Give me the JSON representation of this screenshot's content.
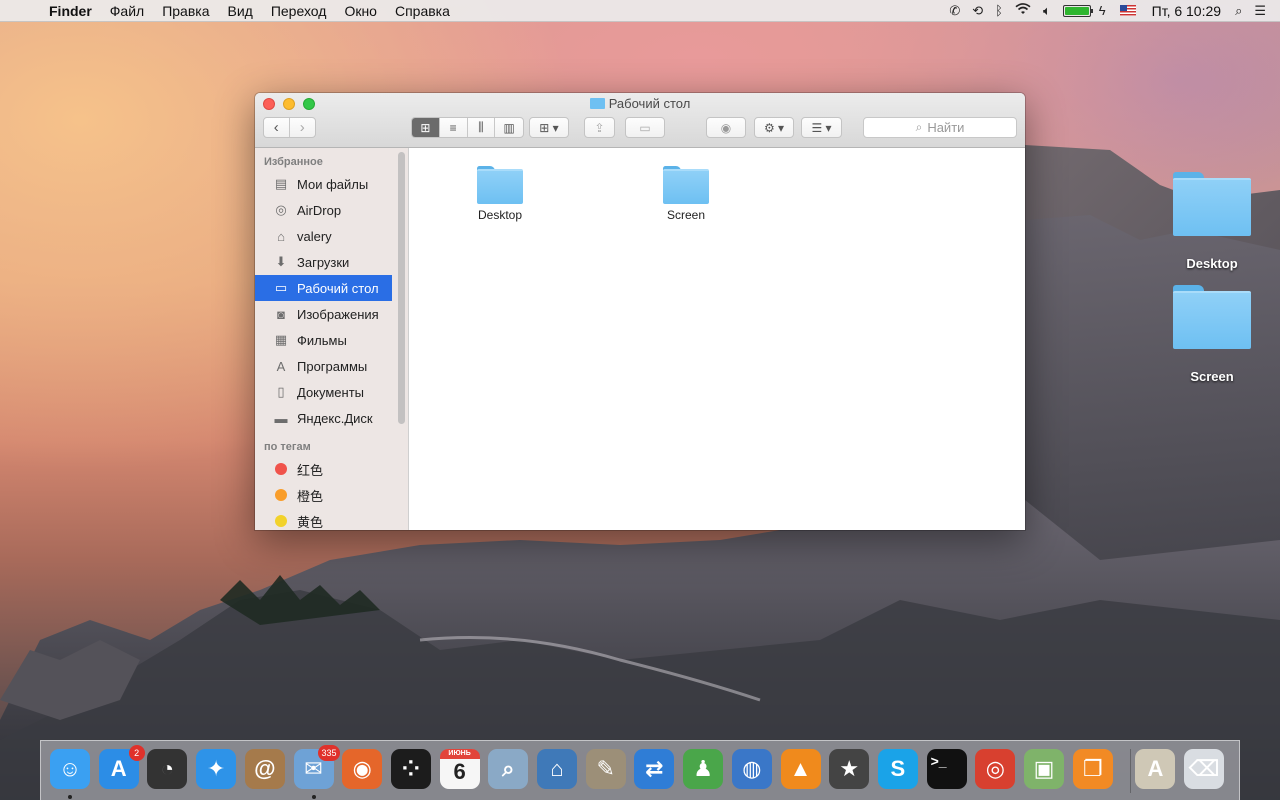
{
  "menubar": {
    "app_name": "Finder",
    "items": [
      "Файл",
      "Правка",
      "Вид",
      "Переход",
      "Окно",
      "Справка"
    ],
    "clock": "Пт, 6 10:29",
    "battery_level": 1.0
  },
  "desktop_icons": [
    {
      "label": "Desktop",
      "icon": "folder-icon"
    },
    {
      "label": "Screen",
      "icon": "folder-icon"
    }
  ],
  "window": {
    "title": "Рабочий стол",
    "search_placeholder": "Найти",
    "sidebar": {
      "favorites_header": "Избранное",
      "favorites": [
        {
          "label": "Мои файлы",
          "icon": "all-files-icon"
        },
        {
          "label": "AirDrop",
          "icon": "airdrop-icon"
        },
        {
          "label": "valery",
          "icon": "home-icon"
        },
        {
          "label": "Загрузки",
          "icon": "downloads-icon"
        },
        {
          "label": "Рабочий стол",
          "icon": "desktop-icon",
          "selected": true
        },
        {
          "label": "Изображения",
          "icon": "camera-icon"
        },
        {
          "label": "Фильмы",
          "icon": "film-icon"
        },
        {
          "label": "Программы",
          "icon": "applications-icon"
        },
        {
          "label": "Документы",
          "icon": "documents-icon"
        },
        {
          "label": "Яндекс.Диск",
          "icon": "folder-icon"
        }
      ],
      "tags_header": "по тегам",
      "tags": [
        {
          "label": "红色",
          "color": "#f0534b"
        },
        {
          "label": "橙色",
          "color": "#f99d2a"
        },
        {
          "label": "黄色",
          "color": "#f2d22b"
        }
      ]
    },
    "files": [
      {
        "label": "Desktop",
        "icon": "folder-icon"
      },
      {
        "label": "Screen",
        "icon": "folder-icon"
      }
    ]
  },
  "dock": {
    "apps": [
      {
        "name": "finder-icon",
        "color": "#3aa0f2",
        "glyph": "☺",
        "running": true
      },
      {
        "name": "app-store-icon",
        "color": "#2c8de6",
        "glyph": "A",
        "badge": "2"
      },
      {
        "name": "dashboard-icon",
        "color": "#333333",
        "glyph": "◔"
      },
      {
        "name": "safari-icon",
        "color": "#2e93e8",
        "glyph": "✦"
      },
      {
        "name": "contacts-icon",
        "color": "#a57a4b",
        "glyph": "@"
      },
      {
        "name": "mail-icon",
        "color": "#6ea2d6",
        "glyph": "✉",
        "badge": "335",
        "running": true
      },
      {
        "name": "firefox-icon",
        "color": "#e5662a",
        "glyph": "◉"
      },
      {
        "name": "blackberry-icon",
        "color": "#1c1c1c",
        "glyph": "⁘"
      },
      {
        "name": "calendar-icon",
        "color": "#f6f6f6",
        "glyph": "6"
      },
      {
        "name": "preview-icon",
        "color": "#8aa9c6",
        "glyph": "⌕"
      },
      {
        "name": "network-app-icon",
        "color": "#3f79b8",
        "glyph": "⌂"
      },
      {
        "name": "gimp-icon",
        "color": "#9c8f78",
        "glyph": "✎"
      },
      {
        "name": "teamviewer-icon",
        "color": "#2f7dd6",
        "glyph": "⇄"
      },
      {
        "name": "android-icon",
        "color": "#4aa64a",
        "glyph": "♟"
      },
      {
        "name": "globe-app-icon",
        "color": "#3a77c8",
        "glyph": "◍"
      },
      {
        "name": "vlc-icon",
        "color": "#f08a1c",
        "glyph": "▲"
      },
      {
        "name": "imovie-icon",
        "color": "#444444",
        "glyph": "★"
      },
      {
        "name": "skype-icon",
        "color": "#1aa3e8",
        "glyph": "S"
      },
      {
        "name": "terminal-icon",
        "color": "#111111",
        "glyph": ">_"
      },
      {
        "name": "chrome-icon",
        "color": "#d8402f",
        "glyph": "◎"
      },
      {
        "name": "photo-app-icon",
        "color": "#7fb36a",
        "glyph": "▣"
      },
      {
        "name": "ibooks-icon",
        "color": "#f28a24",
        "glyph": "❐"
      },
      {
        "name": "applications-folder-icon",
        "color": "#cfc8b6",
        "glyph": "A"
      },
      {
        "name": "trash-icon",
        "color": "#d9dde2",
        "glyph": "⌫"
      }
    ],
    "calendar_month": "ИЮНЬ"
  }
}
